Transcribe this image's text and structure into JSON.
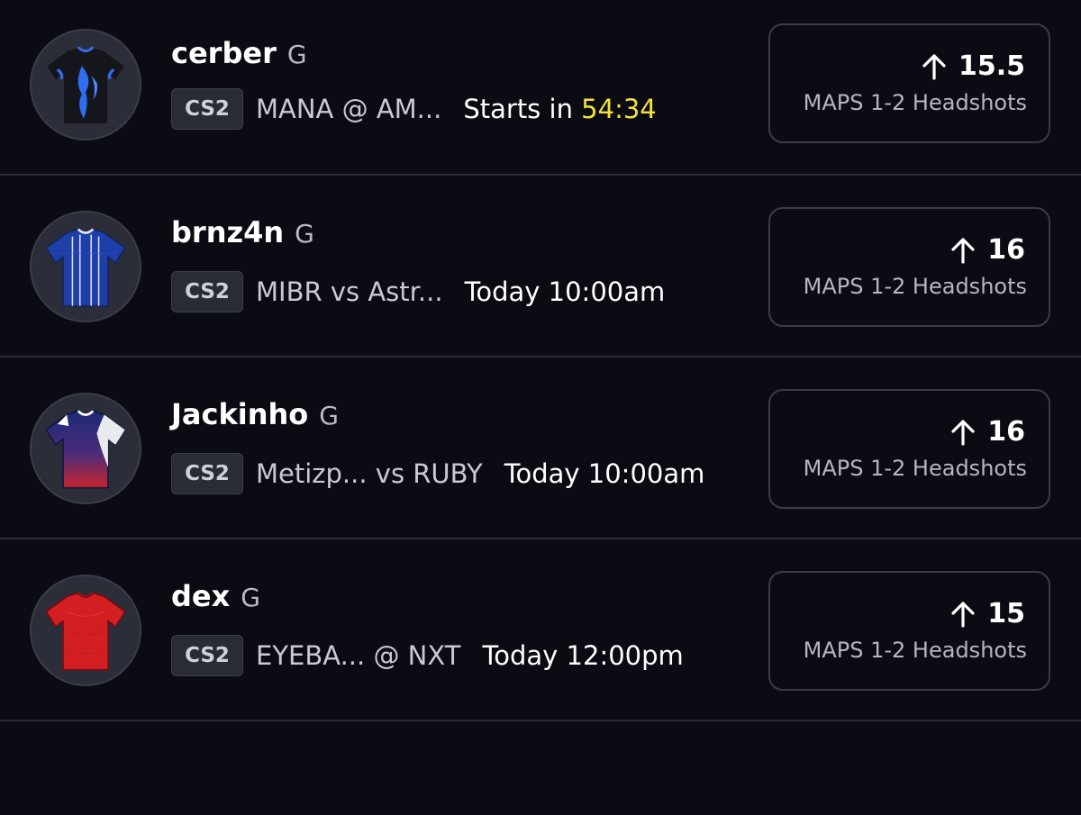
{
  "players": [
    {
      "name": "cerber",
      "position": "G",
      "league": "CS2",
      "matchup": "MANA @ AM...",
      "time_prefix": "Starts in",
      "time_value": "54:34",
      "direction_icon": "arrow-up-icon",
      "line": "15.5",
      "stat": "MAPS 1-2 Headshots",
      "jersey_icon": "jersey-black-blue-flame-icon"
    },
    {
      "name": "brnz4n",
      "position": "G",
      "league": "CS2",
      "matchup": "MIBR vs Astr...",
      "time_prefix": "Today 10:00am",
      "time_value": "",
      "direction_icon": "arrow-up-icon",
      "line": "16",
      "stat": "MAPS 1-2 Headshots",
      "jersey_icon": "jersey-blue-striped-icon"
    },
    {
      "name": "Jackinho",
      "position": "G",
      "league": "CS2",
      "matchup": "Metizp... vs RUBY",
      "time_prefix": "Today 10:00am",
      "time_value": "",
      "direction_icon": "arrow-up-icon",
      "line": "16",
      "stat": "MAPS 1-2 Headshots",
      "jersey_icon": "jersey-navy-red-white-icon"
    },
    {
      "name": "dex",
      "position": "G",
      "league": "CS2",
      "matchup": "EYEBA... @ NXT",
      "time_prefix": "Today 12:00pm",
      "time_value": "",
      "direction_icon": "arrow-up-icon",
      "line": "15",
      "stat": "MAPS 1-2 Headshots",
      "jersey_icon": "jersey-red-icon"
    }
  ],
  "colors": {
    "background": "#0b0c13",
    "divider": "#2a2c35",
    "countdown": "#f2e23b",
    "card_border": "#3a3c47"
  }
}
